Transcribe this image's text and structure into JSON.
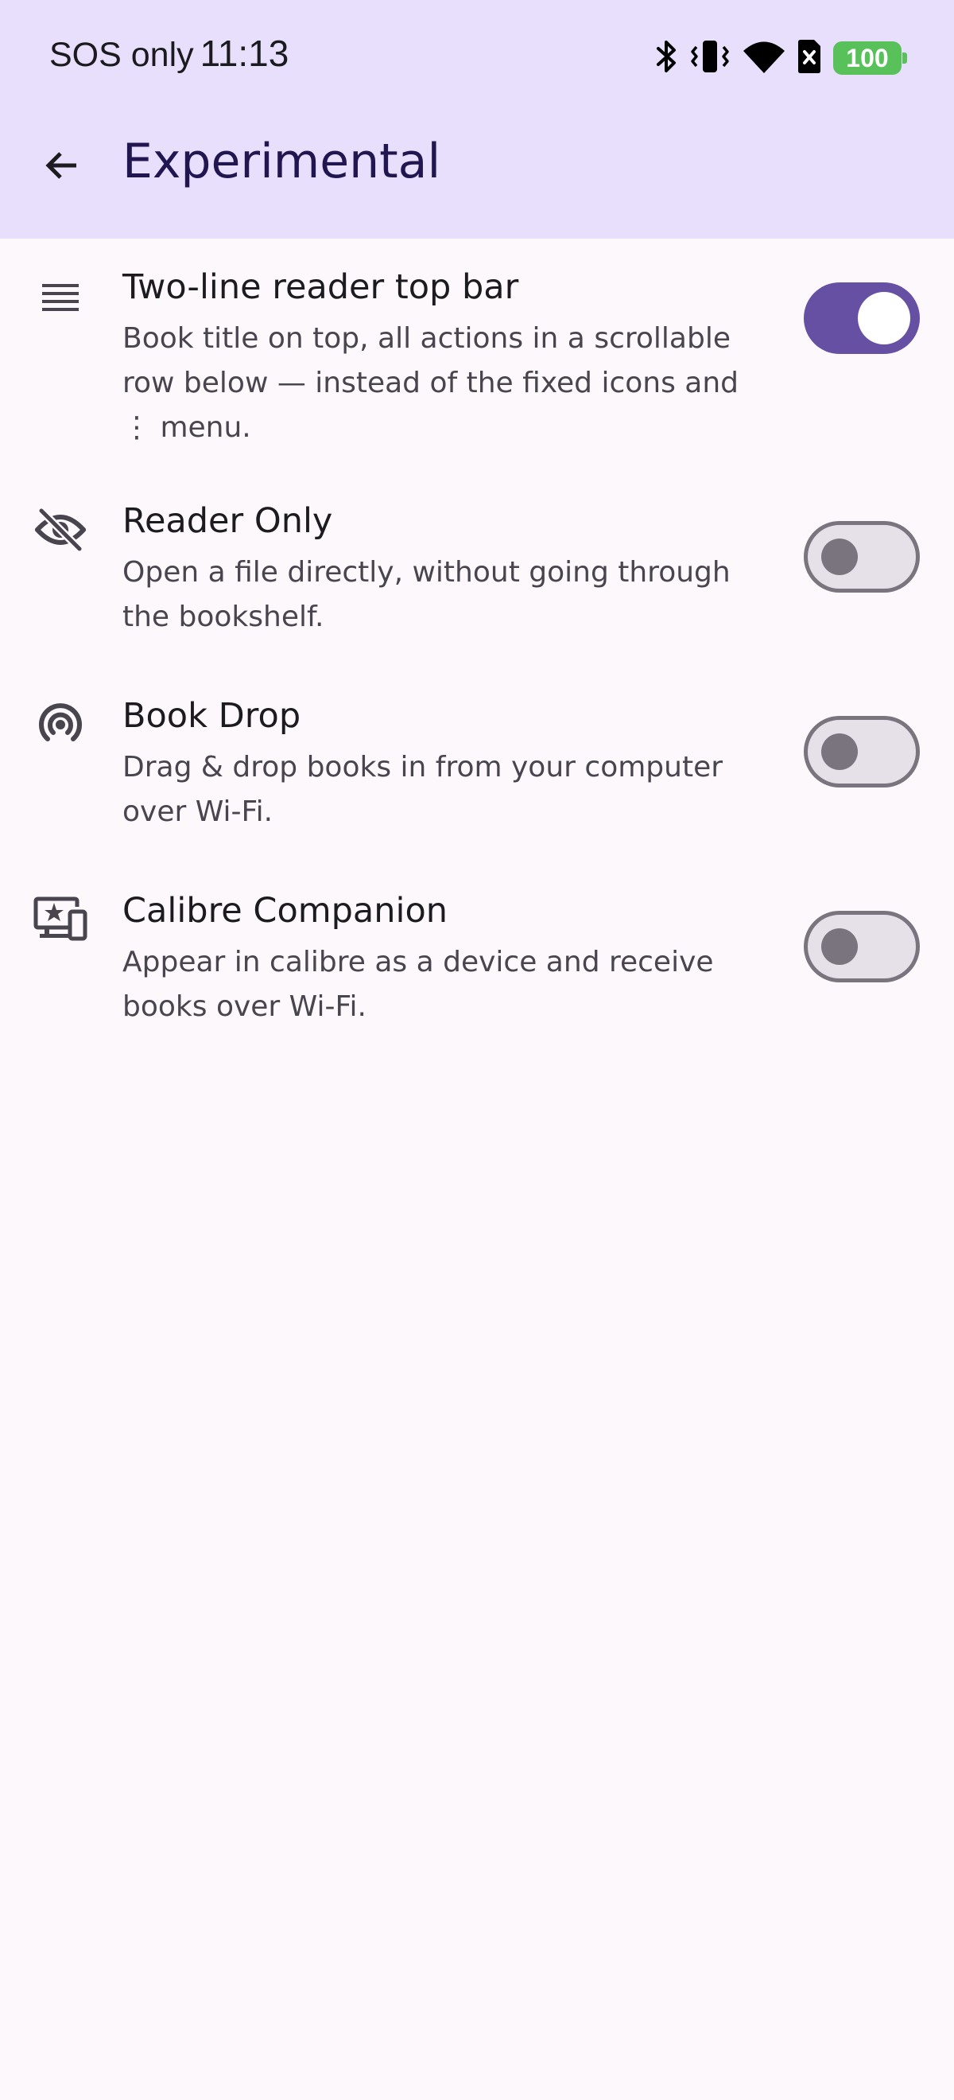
{
  "status_bar": {
    "carrier": "SOS only",
    "time": "11:13",
    "battery": "100",
    "icons": [
      "bluetooth-icon",
      "vibrate-icon",
      "wifi-icon",
      "sim-icon",
      "battery-icon"
    ]
  },
  "app_bar": {
    "title": "Experimental",
    "back_icon": "arrow-back-icon"
  },
  "settings": [
    {
      "icon": "lines-icon",
      "title": "Two-line reader top bar",
      "description": "Book title on top, all actions in a scrollable row below — instead of the fixed icons and ⋮ menu.",
      "enabled": true
    },
    {
      "icon": "visibility-off-icon",
      "title": "Reader Only",
      "description": "Open a file directly, without going through the bookshelf.",
      "enabled": false
    },
    {
      "icon": "broadcast-icon",
      "title": "Book Drop",
      "description": "Drag & drop books in from your computer over Wi-Fi.",
      "enabled": false
    },
    {
      "icon": "devices-star-icon",
      "title": "Calibre Companion",
      "description": "Appear in calibre as a device and receive books over Wi-Fi.",
      "enabled": false
    }
  ],
  "colors": {
    "app_bar_bg": "#e7dffb",
    "page_bg": "#fcf8fc",
    "accent": "#6650a4",
    "title": "#21164f",
    "battery": "#59c15a"
  }
}
